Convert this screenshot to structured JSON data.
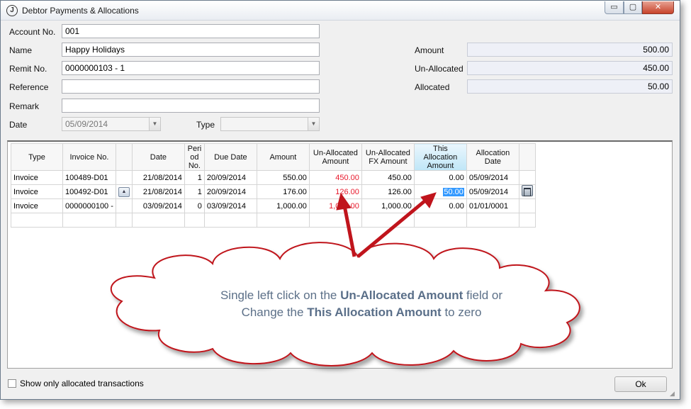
{
  "window": {
    "title": "Debtor Payments & Allocations",
    "icon_letter": "J"
  },
  "controls": {
    "minimize": "▭",
    "maximize": "▢",
    "close": "✕"
  },
  "form": {
    "account_no": {
      "label": "Account No.",
      "value": "001"
    },
    "name": {
      "label": "Name",
      "value": "Happy Holidays"
    },
    "remit_no": {
      "label": "Remit No.",
      "value": "0000000103 - 1"
    },
    "reference": {
      "label": "Reference",
      "value": ""
    },
    "remark": {
      "label": "Remark",
      "value": ""
    },
    "date": {
      "label": "Date",
      "value": "05/09/2014"
    },
    "type": {
      "label": "Type",
      "value": ""
    }
  },
  "amounts": {
    "amount": {
      "label": "Amount",
      "value": "500.00"
    },
    "unallocated": {
      "label": "Un-Allocated",
      "value": "450.00"
    },
    "allocated": {
      "label": "Allocated",
      "value": "50.00"
    }
  },
  "grid": {
    "headers": [
      "Type",
      "Invoice No.",
      "",
      "Date",
      "Peri od No.",
      "Due Date",
      "Amount",
      "Un-Allocated Amount",
      "Un-Allocated FX Amount",
      "This Allocation Amount",
      "Allocation Date",
      ""
    ],
    "rows": [
      {
        "type": "Invoice",
        "invoice": "100489-D01",
        "date": "21/08/2014",
        "period": "1",
        "due": "20/09/2014",
        "amount": "550.00",
        "unalloc": "450.00",
        "fx": "450.00",
        "this_alloc": "0.00",
        "alloc_date": "05/09/2014"
      },
      {
        "type": "Invoice",
        "invoice": "100492-D01",
        "date": "21/08/2014",
        "period": "1",
        "due": "20/09/2014",
        "amount": "176.00",
        "unalloc": "126.00",
        "fx": "126.00",
        "this_alloc": "50.00",
        "alloc_date": "05/09/2014"
      },
      {
        "type": "Invoice",
        "invoice": "0000000100 -",
        "date": "03/09/2014",
        "period": "0",
        "due": "03/09/2014",
        "amount": "1,000.00",
        "unalloc": "1,000.00",
        "fx": "1,000.00",
        "this_alloc": "0.00",
        "alloc_date": "01/01/0001"
      }
    ]
  },
  "callout": {
    "line1_pre": "Single left click on the ",
    "line1_bold": "Un-Allocated Amount",
    "line1_post": " field or",
    "line2_pre": "Change the ",
    "line2_bold": "This Allocation Amount",
    "line2_post": " to zero"
  },
  "footer": {
    "checkbox_label": "Show only allocated transactions",
    "ok": "Ok"
  },
  "colors": {
    "highlight_red": "#e8192c",
    "callout_text": "#5c7088",
    "arrow": "#c0141c",
    "selection_blue": "#3399ff"
  }
}
